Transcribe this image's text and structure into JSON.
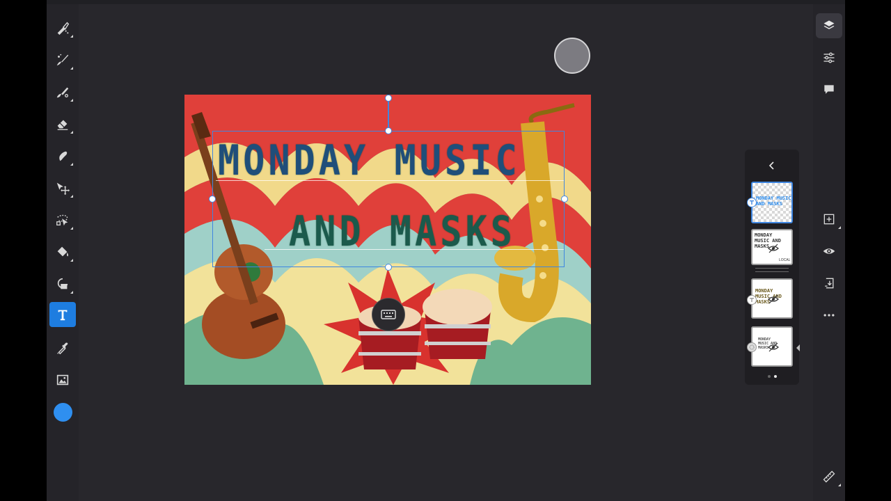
{
  "app": {
    "colors": {
      "background": "#28272c",
      "toolbar": "#252429",
      "accent": "#1e7de0",
      "selection": "#3f86e0",
      "current_color": "#2f8ff0"
    }
  },
  "left_toolbar": {
    "tools": [
      {
        "name": "pixel-brush-icon"
      },
      {
        "name": "live-brush-icon"
      },
      {
        "name": "vector-brush-icon"
      },
      {
        "name": "eraser-icon"
      },
      {
        "name": "smudge-icon"
      },
      {
        "name": "move-icon"
      },
      {
        "name": "selection-icon"
      },
      {
        "name": "fill-icon"
      },
      {
        "name": "shape-icon"
      },
      {
        "name": "text-icon",
        "active": true
      },
      {
        "name": "eyedropper-icon"
      },
      {
        "name": "image-icon"
      }
    ],
    "color_swatch": "#2f8ff0"
  },
  "right_toolbar": {
    "tools": [
      {
        "name": "layers-icon",
        "active": true
      },
      {
        "name": "properties-icon"
      },
      {
        "name": "comments-icon"
      },
      {
        "name": "add-layer-icon"
      },
      {
        "name": "visibility-icon"
      },
      {
        "name": "merge-down-icon"
      },
      {
        "name": "more-icon"
      },
      {
        "name": "ruler-icon"
      }
    ]
  },
  "canvas": {
    "poster_line1": "MONDAY MUSIC",
    "poster_line2": "AND MASKS"
  },
  "layers_panel": {
    "layers": [
      {
        "text": "MONDAY MUSIC\nAND MASKS",
        "selected": true,
        "badge": "T"
      },
      {
        "text": "MONDAY\nMUSIC AND\nMASKS",
        "hidden": true,
        "label": "LOCAL"
      },
      {
        "text": "MONDAY\nMUSIC AND\nMASKS",
        "hidden": true,
        "badge": "T"
      },
      {
        "text": "MONDAY\nMUSIC AND\nMASKS",
        "hidden": true
      }
    ],
    "page_indicator": {
      "count": 2,
      "current": 2
    }
  }
}
